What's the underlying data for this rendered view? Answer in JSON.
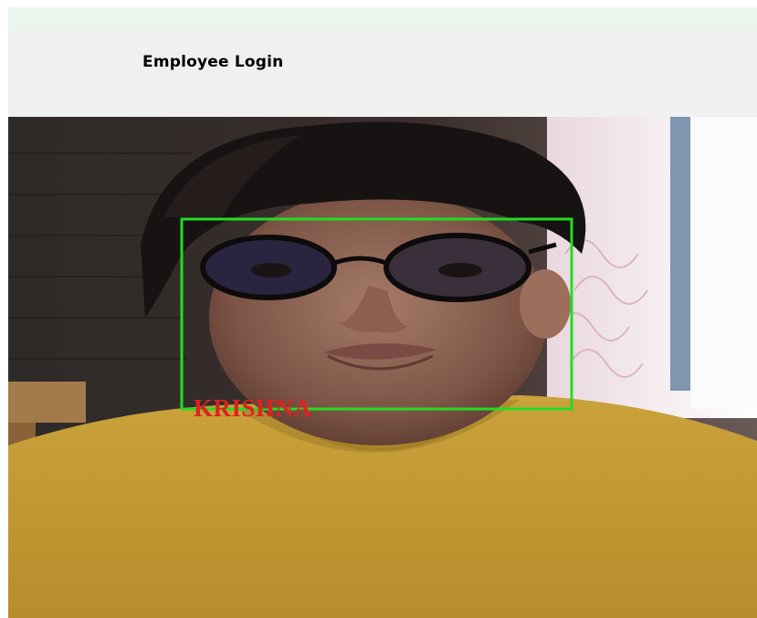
{
  "header": {
    "title": "Employee Login"
  },
  "camera": {
    "recognized_name": "KRISHNA"
  },
  "colors": {
    "top_strip": "#eaf6ec",
    "header_bg": "#f0f0f0",
    "detection_box": "#22dd22",
    "label_text": "#e0201f",
    "shirt": "#c9a23a"
  }
}
